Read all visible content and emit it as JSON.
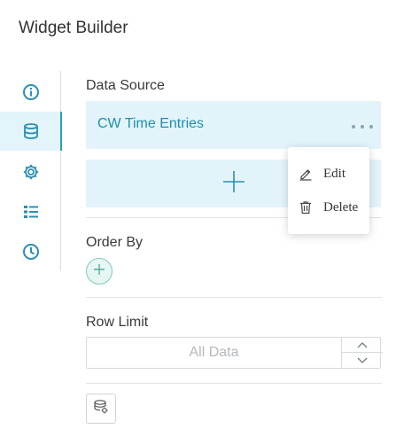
{
  "header": {
    "title": "Widget Builder"
  },
  "sidebar": {
    "items": [
      {
        "icon": "info-icon",
        "active": false
      },
      {
        "icon": "database-icon",
        "active": true
      },
      {
        "icon": "gear-icon",
        "active": false
      },
      {
        "icon": "list-icon",
        "active": false
      },
      {
        "icon": "clock-icon",
        "active": false
      }
    ]
  },
  "data_source": {
    "label": "Data Source",
    "selected": "CW Time Entries",
    "more_icon": "more-horizontal-icon",
    "add_icon": "plus-icon"
  },
  "context_menu": {
    "items": [
      {
        "label": "Edit",
        "icon": "pencil-icon"
      },
      {
        "label": "Delete",
        "icon": "trash-icon"
      }
    ]
  },
  "order_by": {
    "label": "Order By",
    "add_icon": "plus-icon"
  },
  "row_limit": {
    "label": "Row Limit",
    "value": "",
    "placeholder": "All Data",
    "up_icon": "chevron-up-icon",
    "down_icon": "chevron-down-icon"
  },
  "footer": {
    "button_icon": "database-settings-icon"
  },
  "colors": {
    "accent": "#1e8fab",
    "card_bg": "#e2f4fa",
    "icon_blue": "#2a8fb0",
    "order_add_border": "#7fc9c0"
  }
}
